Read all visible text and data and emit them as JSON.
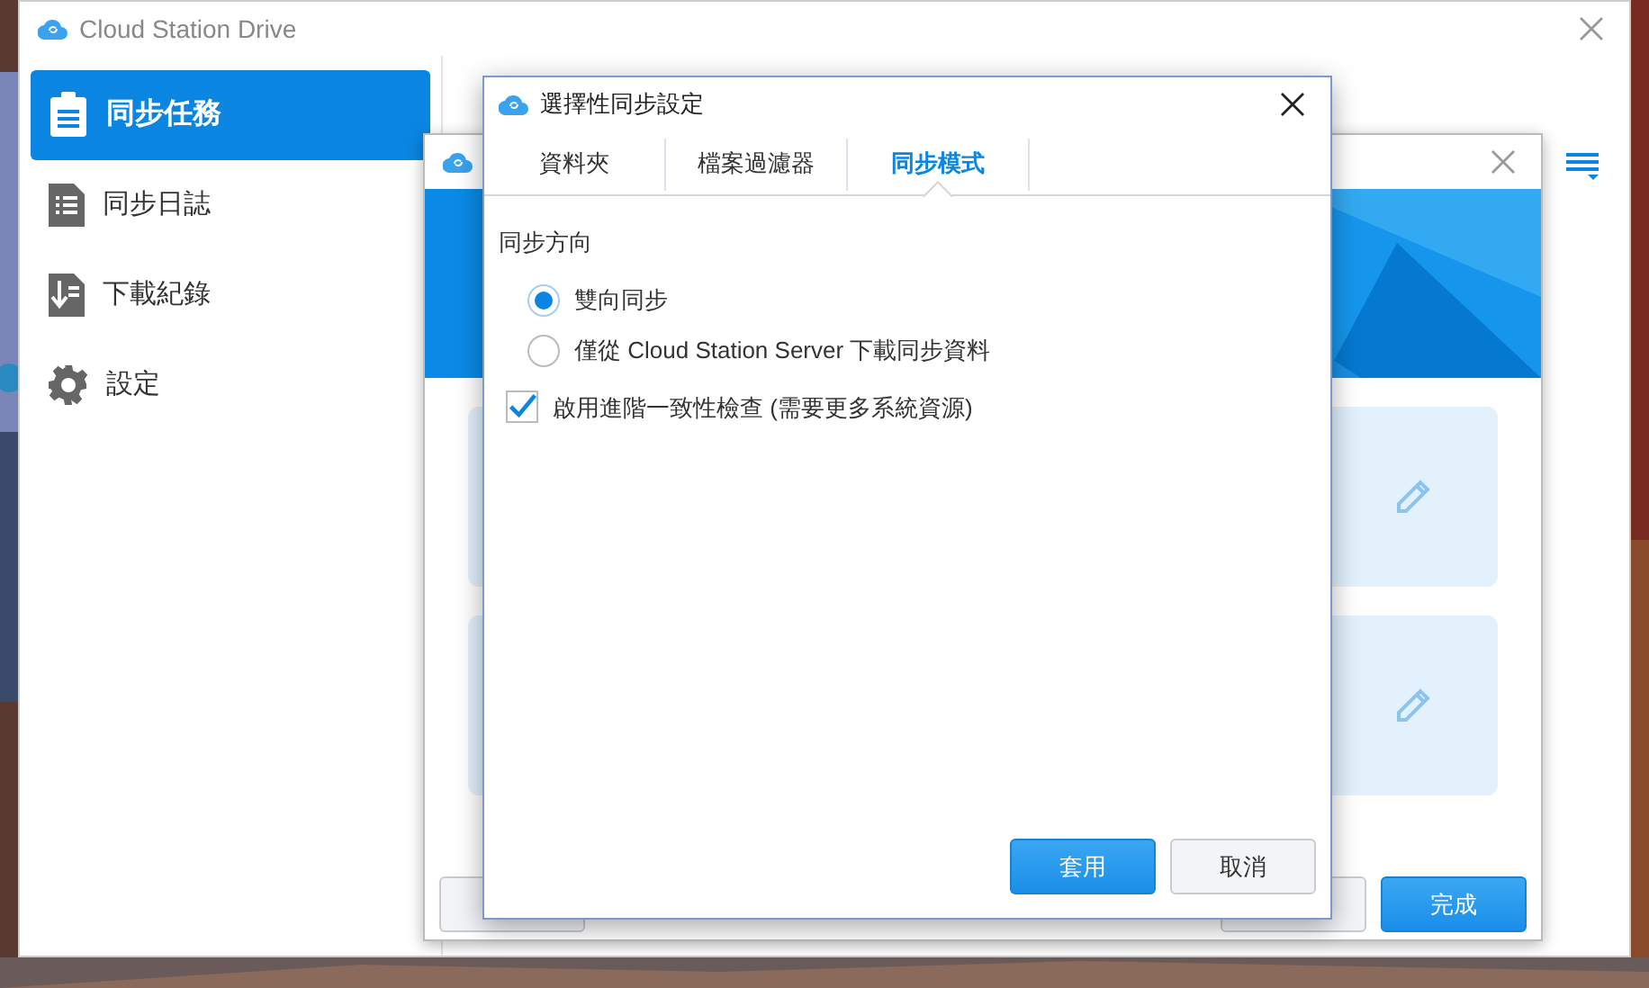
{
  "main_window": {
    "title": "Cloud Station Drive",
    "sidebar": [
      {
        "label": "同步任務",
        "selected": true
      },
      {
        "label": "同步日誌",
        "selected": false
      },
      {
        "label": "下載紀錄",
        "selected": false
      },
      {
        "label": "設定",
        "selected": false
      }
    ]
  },
  "wizard": {
    "task_cards": [
      {
        "kind": "task"
      },
      {
        "kind": "task"
      }
    ],
    "buttons": [
      {
        "kind": "secondary"
      },
      {
        "kind": "secondary"
      },
      {
        "label": "完成",
        "kind": "primary"
      }
    ]
  },
  "dialog": {
    "title": "選擇性同步設定",
    "tabs": [
      {
        "label": "資料夾",
        "selected": false
      },
      {
        "label": "檔案過濾器",
        "selected": false
      },
      {
        "label": "同步模式",
        "selected": true
      }
    ],
    "section_label": "同步方向",
    "options": [
      {
        "label": "雙向同步",
        "selected": true
      },
      {
        "label": "僅從 Cloud Station Server 下載同步資料",
        "selected": false
      }
    ],
    "checkbox": {
      "label": "啟用進階一致性檢查 (需要更多系統資源)",
      "checked": true
    },
    "buttons": [
      {
        "label": "套用",
        "kind": "primary"
      },
      {
        "label": "取消",
        "kind": "secondary"
      }
    ]
  }
}
